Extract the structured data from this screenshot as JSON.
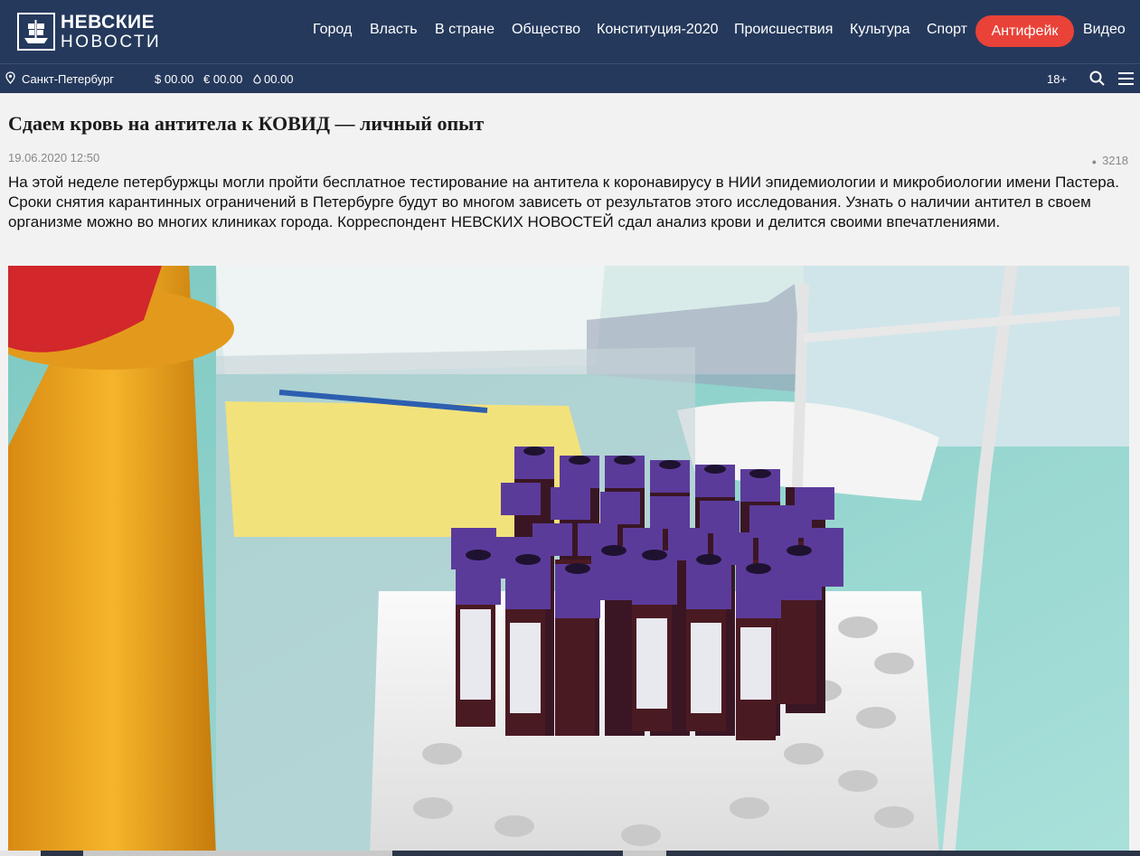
{
  "header": {
    "logo_line1": "НЕВСКИЕ",
    "logo_line2": "НОВОСТИ",
    "nav": [
      "Город",
      "Власть",
      "В стране",
      "Общество",
      "Конституция-2020",
      "Происшествия",
      "Культура",
      "Спорт"
    ],
    "nav_highlight": "Антифейк",
    "nav_last": "Видео"
  },
  "subbar": {
    "city": "Санкт-Петербург",
    "usd": "$ 00.00",
    "eur": "€ 00.00",
    "oil": "00.00",
    "age": "18+"
  },
  "article": {
    "title": "Сдаем кровь на антитела к КОВИД — личный опыт",
    "date": "19.06.2020 12:50",
    "views": "3218",
    "lead": "На этой неделе петербуржцы могли пройти бесплатное тестирование на антитела к коронавирусу в НИИ эпидемиологии и микробиологии имени Пастера. Сроки снятия карантинных ограничений в Петербурге будут во многом зависеть от результатов этого исследования. Узнать о наличии антител в своем организме можно во многих клиниках города. Корреспондент НЕВСКИХ НОВОСТЕЙ сдал анализ крови и делится своими впечатлениями."
  },
  "colors": {
    "header_bg": "#25395c",
    "accent": "#e94238"
  }
}
